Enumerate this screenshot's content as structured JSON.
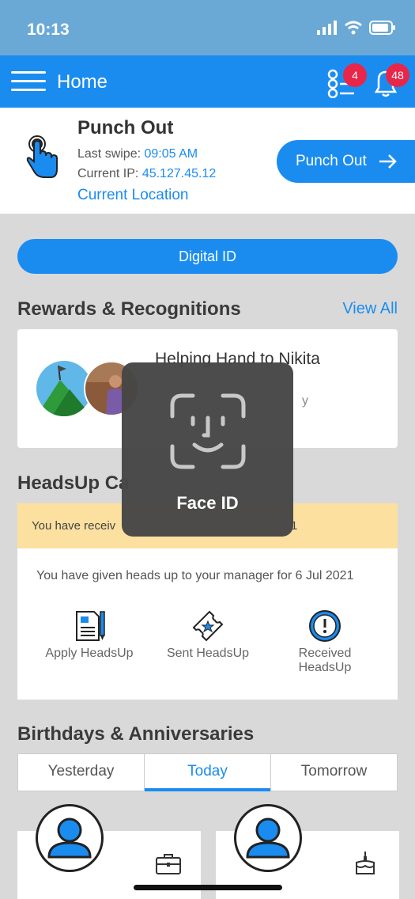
{
  "status_bar": {
    "time": "10:13"
  },
  "app_bar": {
    "title": "Home",
    "tasks_badge": "4",
    "notifications_badge": "48"
  },
  "punch": {
    "title": "Punch Out",
    "last_swipe_label": "Last swipe:",
    "last_swipe_value": "09:05 AM",
    "ip_label": "Current IP:",
    "ip_value": "45.127.45.12",
    "location_link": "Current Location",
    "button_label": "Punch Out",
    "button_icon": "arrow-right-icon"
  },
  "digital_id": {
    "label": "Digital ID"
  },
  "rewards": {
    "title": "Rewards & Recognitions",
    "view_all": "View All",
    "card_title": "Helping Hand to Nikita",
    "card_subtitle": "y"
  },
  "headsup": {
    "title": "HeadsUp Ca",
    "banner_text": "You have receiv",
    "banner_tail": "1",
    "info_text": "You have given heads up to your manager for 6 Jul 2021",
    "actions": [
      {
        "label": "Apply HeadsUp",
        "icon": "document-pen-icon"
      },
      {
        "label": "Sent HeadsUp",
        "icon": "ticket-star-icon"
      },
      {
        "label_line1": "Received",
        "label_line2": "HeadsUp",
        "icon": "alert-clock-icon"
      }
    ]
  },
  "birthdays": {
    "title": "Birthdays & Anniversaries",
    "tabs": [
      "Yesterday",
      "Today",
      "Tomorrow"
    ],
    "active_tab": "Today"
  },
  "face_id": {
    "label": "Face ID"
  },
  "colors": {
    "primary": "#1a8cf0",
    "badge": "#e8264a",
    "banner": "#fbe0a0"
  }
}
